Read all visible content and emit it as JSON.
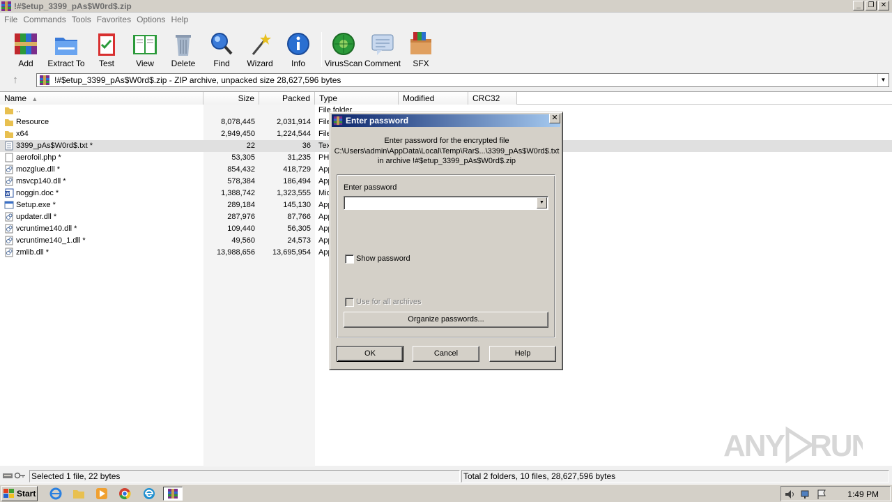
{
  "window": {
    "title": "!#$etup_3399_pAs$W0rd$.zip",
    "controls": [
      "_",
      "❐",
      "✕"
    ]
  },
  "menu": [
    "File",
    "Commands",
    "Tools",
    "Favorites",
    "Options",
    "Help"
  ],
  "toolbar": {
    "add": "Add",
    "extract": "Extract To",
    "test": "Test",
    "view": "View",
    "delete": "Delete",
    "find": "Find",
    "wizard": "Wizard",
    "info": "Info",
    "virusscan": "VirusScan",
    "comment": "Comment",
    "sfx": "SFX"
  },
  "address": {
    "up": "↑",
    "text": "!#$etup_3399_pAs$W0rd$.zip - ZIP archive, unpacked size 28,627,596 bytes"
  },
  "columns": {
    "name": "Name",
    "size": "Size",
    "packed": "Packed",
    "type": "Type",
    "modified": "Modified",
    "crc": "CRC32"
  },
  "files": [
    {
      "name": "..",
      "size": "",
      "packed": "",
      "type": "File folder",
      "icon": "folder-up-icon"
    },
    {
      "name": "Resource",
      "size": "8,078,445",
      "packed": "2,031,914",
      "type": "File",
      "icon": "folder-icon"
    },
    {
      "name": "x64",
      "size": "2,949,450",
      "packed": "1,224,544",
      "type": "File",
      "icon": "folder-icon"
    },
    {
      "name": "3399_pAs$W0rd$.txt *",
      "size": "22",
      "packed": "36",
      "type": "Tex",
      "icon": "text-file-icon"
    },
    {
      "name": "aerofoil.php *",
      "size": "53,305",
      "packed": "31,235",
      "type": "PHI",
      "icon": "file-icon"
    },
    {
      "name": "mozglue.dll *",
      "size": "854,432",
      "packed": "418,729",
      "type": "App",
      "icon": "dll-icon"
    },
    {
      "name": "msvcp140.dll *",
      "size": "578,384",
      "packed": "186,494",
      "type": "App",
      "icon": "dll-icon"
    },
    {
      "name": "noggin.doc *",
      "size": "1,388,742",
      "packed": "1,323,555",
      "type": "Mic",
      "icon": "word-doc-icon"
    },
    {
      "name": "Setup.exe *",
      "size": "289,184",
      "packed": "145,130",
      "type": "App",
      "icon": "exe-icon"
    },
    {
      "name": "updater.dll *",
      "size": "287,976",
      "packed": "87,766",
      "type": "App",
      "icon": "dll-icon"
    },
    {
      "name": "vcruntime140.dll *",
      "size": "109,440",
      "packed": "56,305",
      "type": "App",
      "icon": "dll-icon"
    },
    {
      "name": "vcruntime140_1.dll *",
      "size": "49,560",
      "packed": "24,573",
      "type": "App",
      "icon": "dll-icon"
    },
    {
      "name": "zmlib.dll *",
      "size": "13,988,656",
      "packed": "13,695,954",
      "type": "App",
      "icon": "dll-icon"
    }
  ],
  "selected_file": "3399_pAs$W0rd$.txt *",
  "status": {
    "left": "Selected 1 file, 22 bytes",
    "right": "Total 2 folders, 10 files, 28,627,596 bytes"
  },
  "dialog": {
    "title": "Enter password",
    "close": "✕",
    "message_line1": "Enter password for the encrypted file",
    "message_line2": "C:\\Users\\admin\\AppData\\Local\\Temp\\Rar$...\\3399_pAs$W0rd$.txt",
    "message_line3": "in archive !#$etup_3399_pAs$W0rd$.zip",
    "password_label": "Enter password",
    "password_value": "",
    "show_password": "Show password",
    "use_for_all": "Use for all archives",
    "organize": "Organize passwords...",
    "ok": "OK",
    "cancel": "Cancel",
    "help": "Help"
  },
  "taskbar": {
    "start": "Start",
    "clock": "1:49 PM"
  },
  "watermark": "ANY RUN",
  "colors": {
    "dialog_title_start": "#0a246a",
    "dialog_title_end": "#a6caf0",
    "selection": "#e0e0e0",
    "chrome": "#d4d0c8"
  }
}
